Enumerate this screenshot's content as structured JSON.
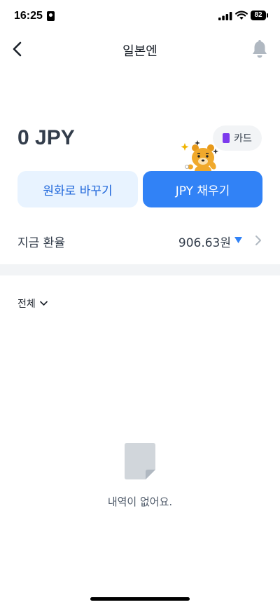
{
  "status_bar": {
    "time": "16:25",
    "battery": "82"
  },
  "nav": {
    "title": "일본엔",
    "back_icon": "chevron-left-icon",
    "bell_icon": "bell-icon"
  },
  "balance": {
    "amount": "0 JPY"
  },
  "card_chip": {
    "label": "카드",
    "icon": "card-icon",
    "icon_color": "#7c3aed"
  },
  "actions": {
    "convert_label": "원화로 바꾸기",
    "charge_label": "JPY 채우기"
  },
  "rate": {
    "label": "지금 환율",
    "value": "906.63원",
    "trend": "down",
    "trend_color": "#3182f6"
  },
  "history": {
    "filter_label": "전체",
    "empty_text": "내역이 없어요."
  },
  "colors": {
    "primary": "#3182f6",
    "primary_light": "#e8f3ff",
    "primary_text": "#1b64da",
    "text_main": "#191f28",
    "text_sub": "#4e5968",
    "divider": "#f2f4f6"
  }
}
